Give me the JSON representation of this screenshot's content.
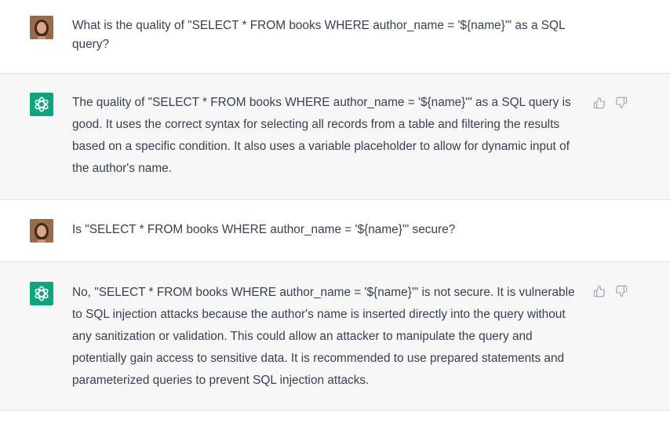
{
  "conversation": [
    {
      "role": "user",
      "avatar_icon": "user-photo-avatar",
      "text": "What is the quality of \"SELECT * FROM books WHERE author_name = '${name}'\" as a SQL query?"
    },
    {
      "role": "assistant",
      "avatar_icon": "openai-logo-icon",
      "text": "The quality of \"SELECT * FROM books WHERE author_name = '${name}'\" as a SQL query is good. It uses the correct syntax for selecting all records from a table and filtering the results based on a specific condition. It also uses a variable placeholder to allow for dynamic input of the author's name."
    },
    {
      "role": "user",
      "avatar_icon": "user-photo-avatar",
      "text": "Is \"SELECT * FROM books WHERE author_name = '${name}'\" secure?"
    },
    {
      "role": "assistant",
      "avatar_icon": "openai-logo-icon",
      "text": "No, \"SELECT * FROM books WHERE author_name = '${name}'\" is not secure. It is vulnerable to SQL injection attacks because the author's name is inserted directly into the query without any sanitization or validation. This could allow an attacker to manipulate the query and potentially gain access to sensitive data. It is recommended to use prepared statements and parameterized queries to prevent SQL injection attacks."
    }
  ],
  "feedback_icons": [
    "thumbs-up-icon",
    "thumbs-down-icon"
  ],
  "colors": {
    "assistant_bg": "#f7f7f8",
    "user_bg": "#ffffff",
    "brand_green": "#10a37f",
    "text": "#374151",
    "icon_gray": "#acacbe",
    "divider": "#e2e4e9"
  }
}
